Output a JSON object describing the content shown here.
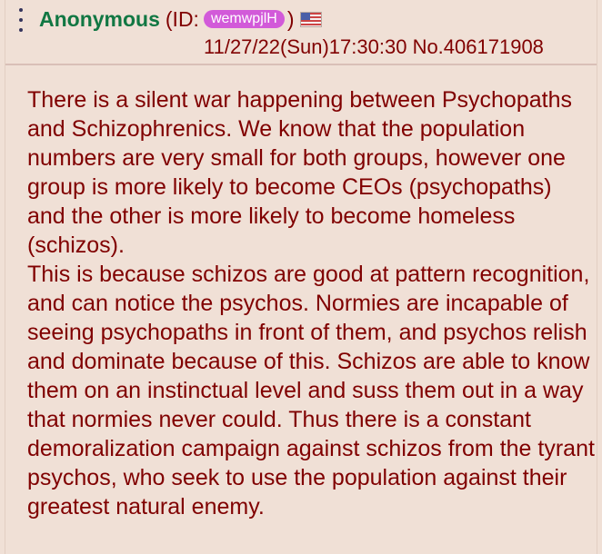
{
  "post": {
    "name": "Anonymous",
    "id_prefix": "(ID:",
    "id_value": "wemwpjlH",
    "id_suffix": ")",
    "flag_icon": "us-flag-icon",
    "timestamp": "11/27/22(Sun)17:30:30",
    "post_number": "No.406171908",
    "paragraphs": [
      "There is a silent war happening between Psychopaths and Schizophrenics. We know that the population numbers are very small for both groups, however one group is more likely to become CEOs (psychopaths) and the other is more likely to become homeless (schizos).",
      "This is because schizos are good at pattern recognition, and can notice the psychos. Normies are incapable of seeing psychopaths in front of them, and psychos relish and dominate because of this. Schizos are able to know them on an instinctual level and suss them out in a way that normies never could. Thus there is a constant demoralization campaign against schizos from the tyrant psychos, who seek to use the population against their greatest natural enemy."
    ]
  },
  "colors": {
    "background": "#f0e0d6",
    "name": "#117743",
    "text": "#800000",
    "id_badge": "#d25ad9"
  }
}
